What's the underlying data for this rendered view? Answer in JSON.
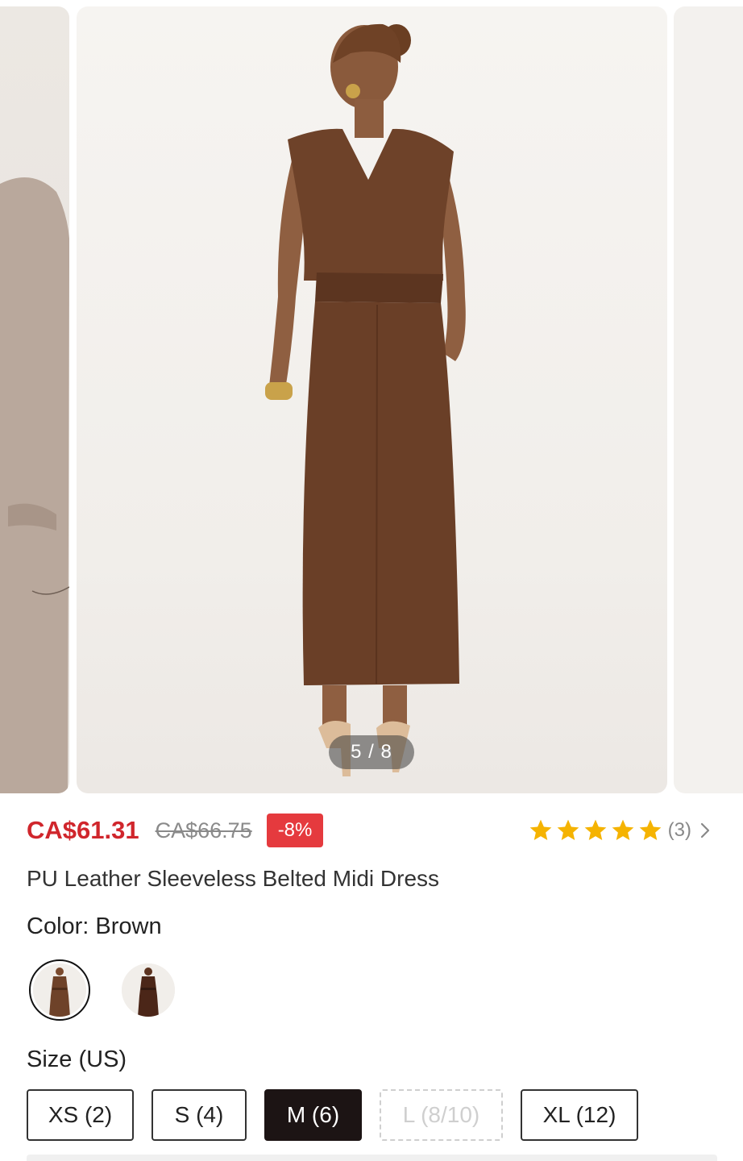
{
  "gallery": {
    "counter": "5 / 8",
    "current_index": 5,
    "total": 8
  },
  "price": {
    "current": "CA$61.31",
    "original": "CA$66.75",
    "discount": "-8%",
    "accent_color": "#d0262c",
    "badge_color": "#e53a3e"
  },
  "rating": {
    "stars": 5,
    "review_count": "(3)",
    "star_color": "#f5b301"
  },
  "product": {
    "title": "PU Leather Sleeveless Belted Midi Dress"
  },
  "color": {
    "label": "Color: Brown",
    "swatches": [
      {
        "name": "swatch-brown",
        "selected": true
      },
      {
        "name": "swatch-dark-brown",
        "selected": false
      }
    ]
  },
  "size": {
    "title": "Size (US)",
    "options": [
      {
        "label": "XS (2)",
        "state": "available"
      },
      {
        "label": "S (4)",
        "state": "available"
      },
      {
        "label": "M (6)",
        "state": "selected"
      },
      {
        "label": "L (8/10)",
        "state": "unavailable"
      },
      {
        "label": "XL (12)",
        "state": "available"
      }
    ]
  }
}
